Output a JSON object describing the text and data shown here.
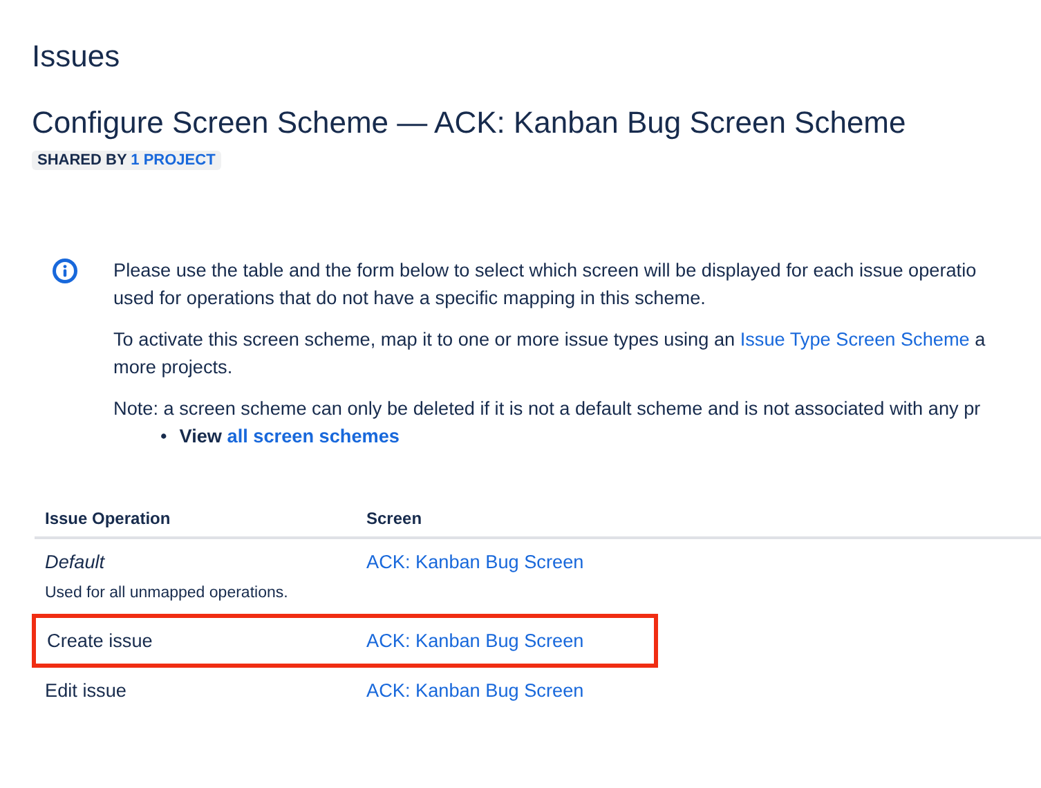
{
  "page_title": "Issues",
  "heading": "Configure Screen Scheme — ACK: Kanban Bug Screen Scheme",
  "badge": {
    "prefix": "SHARED BY",
    "link": "1 PROJECT"
  },
  "info": {
    "paragraphs": [
      {
        "segments": [
          {
            "kind": "text",
            "text": "Please use the table and the form below to select which screen will be displayed for each issue operatio"
          },
          {
            "kind": "break"
          },
          {
            "kind": "text",
            "text": "used for operations that do not have a specific mapping in this scheme."
          }
        ]
      },
      {
        "segments": [
          {
            "kind": "text",
            "text": "To activate this screen scheme, map it to one or more issue types using an "
          },
          {
            "kind": "link",
            "text": "Issue Type Screen Scheme"
          },
          {
            "kind": "text",
            "text": " a"
          },
          {
            "kind": "break"
          },
          {
            "kind": "text",
            "text": "more projects."
          }
        ]
      },
      {
        "segments": [
          {
            "kind": "text",
            "text": "Note: a screen scheme can only be deleted if it is not a default scheme and is not associated with any pr"
          }
        ]
      }
    ],
    "bullet": {
      "marker": "•",
      "prefix": "View",
      "link": "all screen schemes"
    }
  },
  "table": {
    "columns": [
      "Issue Operation",
      "Screen"
    ],
    "rows": [
      {
        "operation": "Default",
        "italic": true,
        "note": "Used for all unmapped operations.",
        "screen": "ACK: Kanban Bug Screen",
        "highlighted": false
      },
      {
        "operation": "Create issue",
        "italic": false,
        "screen": "ACK: Kanban Bug Screen",
        "highlighted": true
      },
      {
        "operation": "Edit issue",
        "italic": false,
        "screen": "ACK: Kanban Bug Screen",
        "highlighted": false
      }
    ]
  }
}
